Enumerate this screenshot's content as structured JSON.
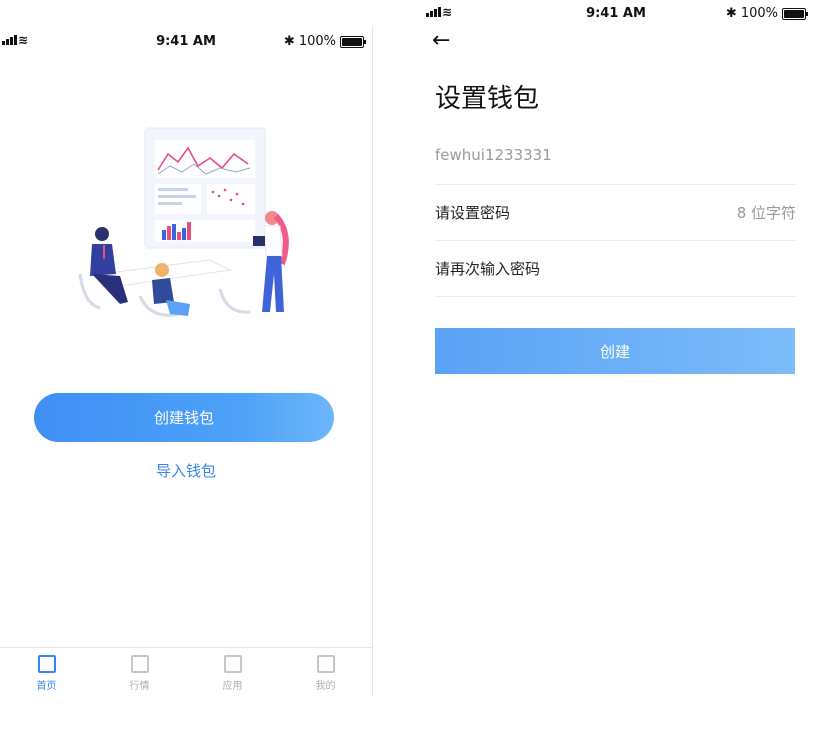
{
  "left": {
    "status_bar": {
      "time": "9:41 AM",
      "battery": "100%"
    },
    "create_wallet_label": "创建钱包",
    "import_wallet_label": "导入钱包",
    "tabs": [
      {
        "label": "首页",
        "icon": "home-icon",
        "active": true
      },
      {
        "label": "行情",
        "icon": "market-icon",
        "active": false
      },
      {
        "label": "应用",
        "icon": "apps-icon",
        "active": false
      },
      {
        "label": "我的",
        "icon": "profile-icon",
        "active": false
      }
    ]
  },
  "right": {
    "status_bar": {
      "time": "9:41 AM",
      "battery": "100%"
    },
    "title": "设置钱包",
    "wallet_name_value": "fewhui1233331",
    "password_label": "请设置密码",
    "password_hint": "8 位字符",
    "confirm_password_label": "请再次输入密码",
    "create_button_label": "创建"
  },
  "colors": {
    "accent": "#3a86e8",
    "button_gradient_start": "#3f8ff6",
    "button_gradient_end": "#6cb6fa"
  }
}
